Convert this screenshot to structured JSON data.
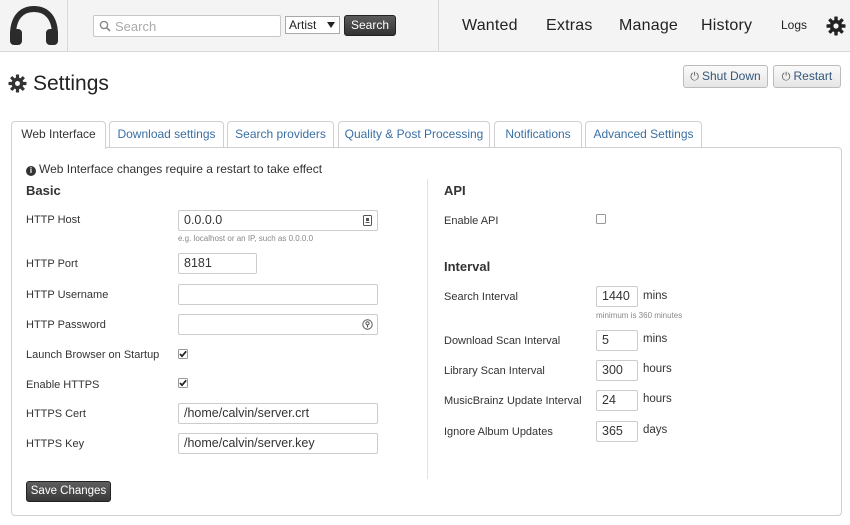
{
  "header": {
    "search_placeholder": "Search",
    "search_type": "Artist",
    "search_button": "Search",
    "nav": [
      "Wanted",
      "Extras",
      "Manage",
      "History"
    ],
    "logs": "Logs"
  },
  "page": {
    "title": "Settings",
    "shutdown": "Shut Down",
    "restart": "Restart"
  },
  "tabs": [
    "Web Interface",
    "Download settings",
    "Search providers",
    "Quality & Post Processing",
    "Notifications",
    "Advanced Settings"
  ],
  "notice": "Web Interface changes require a restart to take effect",
  "basic": {
    "heading": "Basic",
    "host_label": "HTTP Host",
    "host_value": "0.0.0.0",
    "host_hint": "e.g. localhost or an IP, such as 0.0.0.0",
    "port_label": "HTTP Port",
    "port_value": "8181",
    "username_label": "HTTP Username",
    "username_value": "",
    "password_label": "HTTP Password",
    "password_value": "",
    "launch_label": "Launch Browser on Startup",
    "launch_checked": true,
    "https_label": "Enable HTTPS",
    "https_checked": true,
    "cert_label": "HTTPS Cert",
    "cert_value": "/home/calvin/server.crt",
    "key_label": "HTTPS Key",
    "key_value": "/home/calvin/server.key"
  },
  "api": {
    "heading": "API",
    "enable_label": "Enable API",
    "enable_checked": false
  },
  "interval": {
    "heading": "Interval",
    "search_label": "Search Interval",
    "search_value": "1440",
    "search_unit": "mins",
    "search_hint": "minimum is 360 minutes",
    "download_label": "Download Scan Interval",
    "download_value": "5",
    "download_unit": "mins",
    "library_label": "Library Scan Interval",
    "library_value": "300",
    "library_unit": "hours",
    "mb_label": "MusicBrainz Update Interval",
    "mb_value": "24",
    "mb_unit": "hours",
    "ignore_label": "Ignore Album Updates",
    "ignore_value": "365",
    "ignore_unit": "days"
  },
  "save_button": "Save Changes",
  "colors": {
    "link": "#3a6fa4",
    "dark_button": "#3c3c3c",
    "header_bg": "#f4f4f4"
  }
}
